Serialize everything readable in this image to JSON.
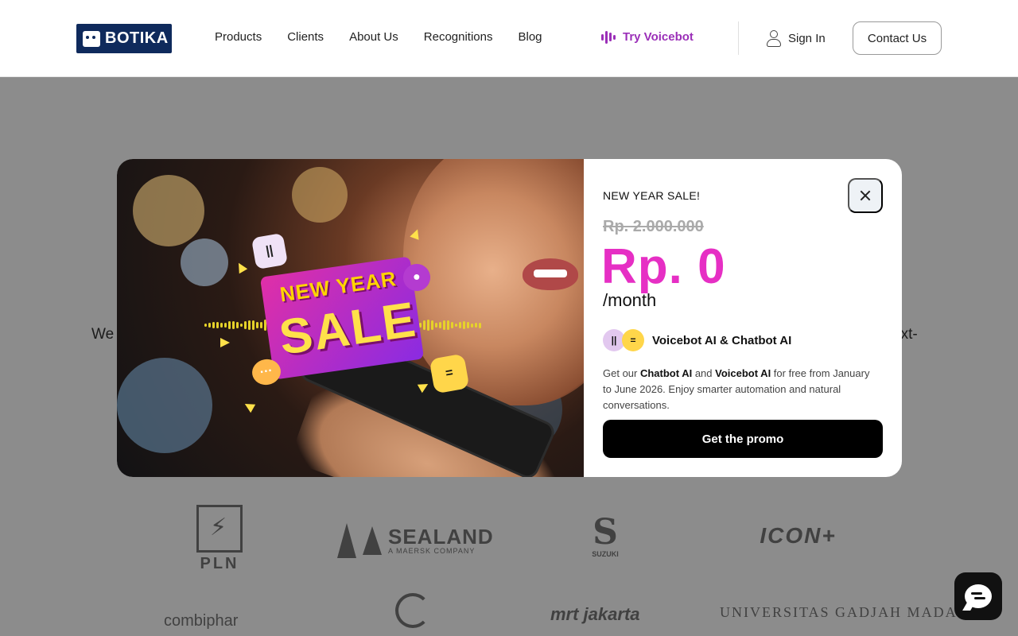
{
  "header": {
    "logo_text": "BOTIKA",
    "nav": [
      "Products",
      "Clients",
      "About Us",
      "Recognitions",
      "Blog"
    ],
    "try_label": "Try Voicebot",
    "signin_label": "Sign In",
    "contact_label": "Contact Us",
    "accent_color": "#9b2fb8"
  },
  "background": {
    "hero_left": "We",
    "hero_right": "ext-",
    "client_logos": [
      "PLN",
      "SEALAND",
      "A MAERSK COMPANY",
      "SUZUKI",
      "ICON+",
      "combiphar",
      "mrt jakarta",
      "UNIVERSITAS GADJAH MADA"
    ]
  },
  "modal": {
    "image": {
      "headline_small": "NEW YEAR",
      "headline_big": "SALE"
    },
    "label": "NEW YEAR SALE!",
    "old_price": "Rp. 2.000.000",
    "new_price": "Rp. 0",
    "period": "/month",
    "product_name": "Voicebot AI & Chatbot AI",
    "desc": {
      "prefix": "Get our ",
      "p1": "Chatbot AI",
      "mid": " and ",
      "p2": "Voicebot AI",
      "suffix": " for free from January to June 2026. Enjoy smarter automation and natural conversations."
    },
    "cta_label": "Get the promo",
    "price_color": "#e62fc4"
  },
  "icons": [
    "botika-logo-icon",
    "voicebot-bars-icon",
    "user-icon",
    "close-icon",
    "chat-icon"
  ]
}
